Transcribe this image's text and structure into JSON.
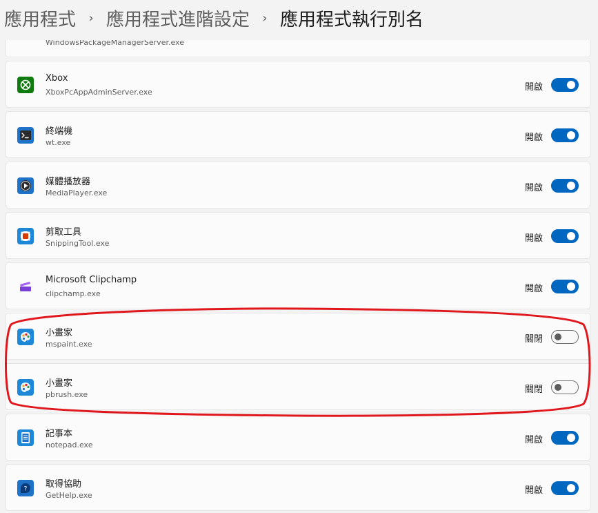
{
  "breadcrumb": {
    "items": [
      "應用程式",
      "應用程式進階設定",
      "應用程式執行別名"
    ],
    "separator": "›"
  },
  "partial_item": {
    "exe": "WindowsPackageManagerServer.exe"
  },
  "apps": [
    {
      "name": "Xbox",
      "exe": "XboxPcAppAdminServer.exe",
      "state_label": "開啟",
      "enabled": true,
      "icon": "xbox-icon"
    },
    {
      "name": "終端機",
      "exe": "wt.exe",
      "state_label": "開啟",
      "enabled": true,
      "icon": "terminal-icon"
    },
    {
      "name": "媒體播放器",
      "exe": "MediaPlayer.exe",
      "state_label": "開啟",
      "enabled": true,
      "icon": "media-player-icon"
    },
    {
      "name": "剪取工具",
      "exe": "SnippingTool.exe",
      "state_label": "開啟",
      "enabled": true,
      "icon": "snipping-tool-icon"
    },
    {
      "name": "Microsoft Clipchamp",
      "exe": "clipchamp.exe",
      "state_label": "開啟",
      "enabled": true,
      "icon": "clipchamp-icon"
    },
    {
      "name": "小畫家",
      "exe": "mspaint.exe",
      "state_label": "關閉",
      "enabled": false,
      "icon": "paint-icon"
    },
    {
      "name": "小畫家",
      "exe": "pbrush.exe",
      "state_label": "關閉",
      "enabled": false,
      "icon": "paint-icon"
    },
    {
      "name": "記事本",
      "exe": "notepad.exe",
      "state_label": "開啟",
      "enabled": true,
      "icon": "notepad-icon"
    },
    {
      "name": "取得協助",
      "exe": "GetHelp.exe",
      "state_label": "開啟",
      "enabled": true,
      "icon": "get-help-icon"
    }
  ],
  "colors": {
    "accent": "#0067c0",
    "annotation": "#e0181e",
    "background": "#f3f3f3",
    "card": "#fbfbfb"
  }
}
